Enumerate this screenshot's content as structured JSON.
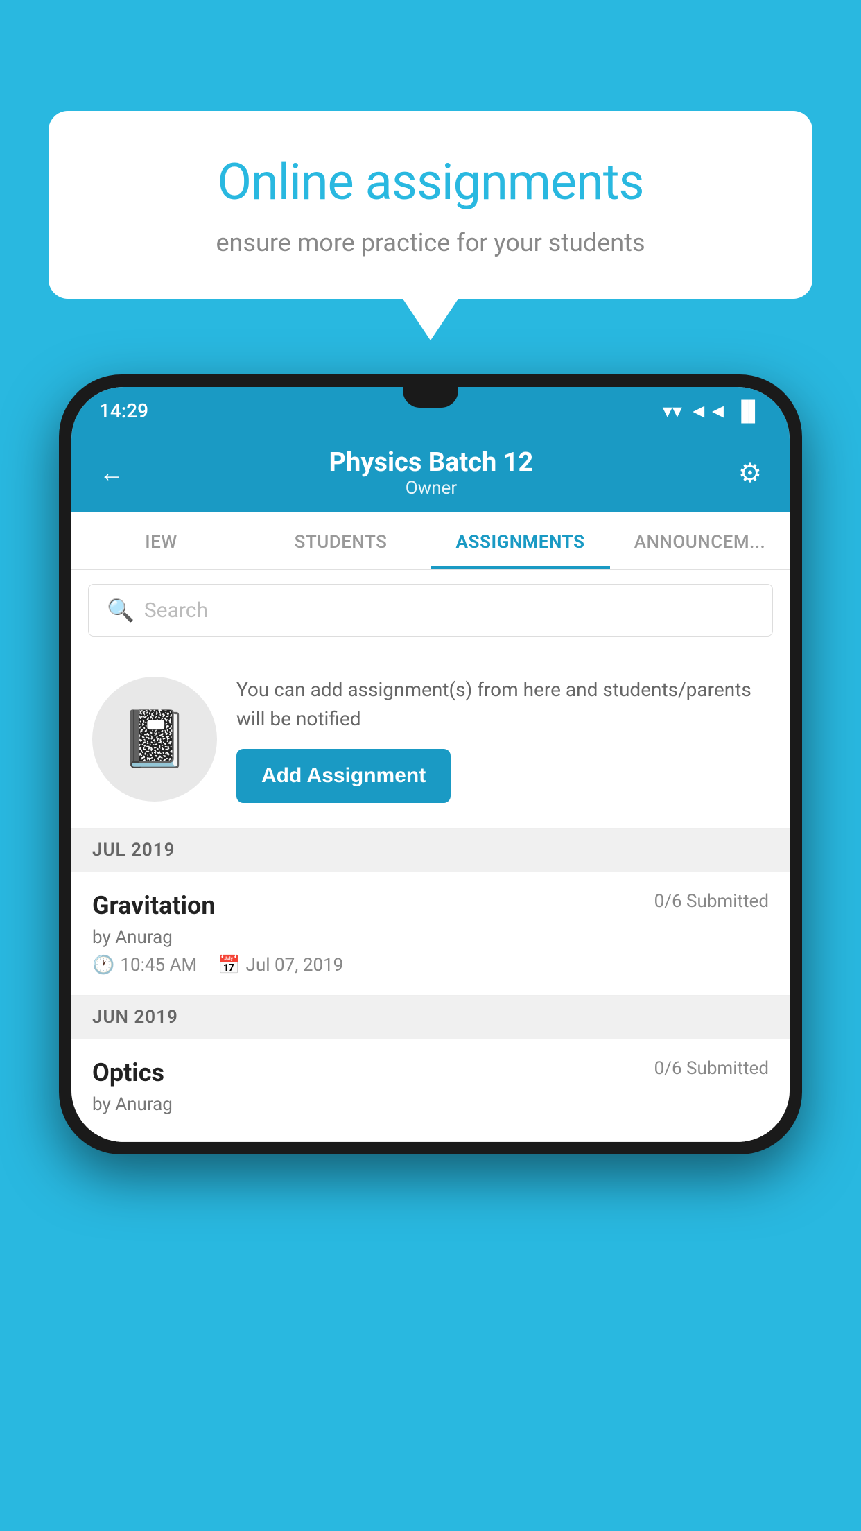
{
  "background_color": "#29B8E0",
  "speech_bubble": {
    "title": "Online assignments",
    "subtitle": "ensure more practice for your students"
  },
  "status_bar": {
    "time": "14:29",
    "wifi": "▾",
    "signal": "▲",
    "battery": "▮"
  },
  "header": {
    "title": "Physics Batch 12",
    "subtitle": "Owner",
    "back_label": "←",
    "settings_label": "⚙"
  },
  "tabs": [
    {
      "label": "IEW",
      "active": false
    },
    {
      "label": "STUDENTS",
      "active": false
    },
    {
      "label": "ASSIGNMENTS",
      "active": true
    },
    {
      "label": "ANNOUNCEM...",
      "active": false
    }
  ],
  "search": {
    "placeholder": "Search"
  },
  "promo": {
    "text": "You can add assignment(s) from here and students/parents will be notified",
    "button_label": "Add Assignment"
  },
  "sections": [
    {
      "month": "JUL 2019",
      "assignments": [
        {
          "name": "Gravitation",
          "submitted": "0/6 Submitted",
          "by": "by Anurag",
          "time": "10:45 AM",
          "date": "Jul 07, 2019"
        }
      ]
    },
    {
      "month": "JUN 2019",
      "assignments": [
        {
          "name": "Optics",
          "submitted": "0/6 Submitted",
          "by": "by Anurag",
          "time": "",
          "date": ""
        }
      ]
    }
  ]
}
